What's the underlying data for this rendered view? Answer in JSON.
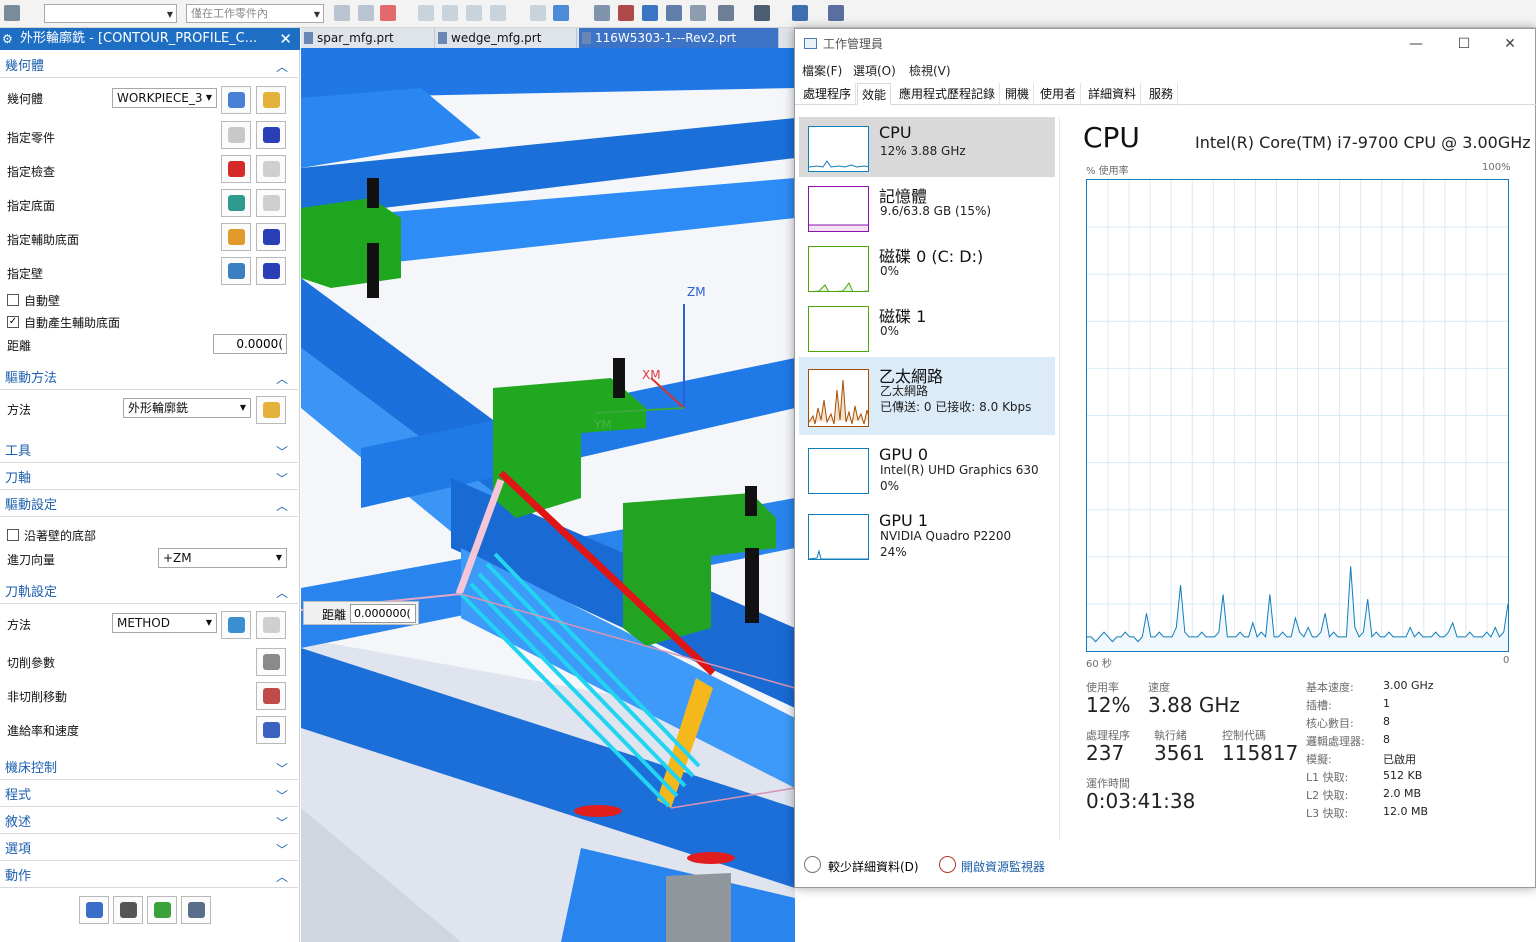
{
  "toolbar": {
    "combo1": "",
    "combo2": "僅在工作零件內"
  },
  "panel": {
    "title": "外形輪廓銑 - [CONTOUR_PROFILE_C...",
    "geometry": {
      "header": "幾何體",
      "geometry_label": "幾何體",
      "workpiece_value": "WORKPIECE_3",
      "specify_part": "指定零件",
      "specify_check": "指定檢查",
      "specify_floor": "指定底面",
      "specify_aux_floor": "指定輔助底面",
      "specify_wall": "指定壁",
      "auto_wall": "自動壁",
      "auto_aux_floor": "自動產生輔助底面",
      "distance_label": "距離",
      "distance_value": "0.0000("
    },
    "drive": {
      "header": "驅動方法",
      "method_label": "方法",
      "method_value": "外形輪廓銑"
    },
    "tool_header": "工具",
    "axis_header": "刀軸",
    "drive_settings": {
      "header": "驅動設定",
      "along_wall_bottom": "沿著壁的底部",
      "approach_label": "進刀向量",
      "approach_value": "+ZM"
    },
    "path_settings": {
      "header": "刀軌設定",
      "method_label": "方法",
      "method_value": "METHOD",
      "cut_params": "切削參數",
      "non_cut": "非切削移動",
      "feeds": "進給率和速度"
    },
    "machine_control": "機床控制",
    "program": "程式",
    "description": "敘述",
    "options": "選項",
    "actions": "動作"
  },
  "viewport": {
    "tabs": [
      "spar_mfg.prt",
      "wedge_mfg.prt",
      "116W5303-1---Rev2.prt"
    ],
    "axis_zm": "ZM",
    "axis_xm": "XM",
    "axis_ym": "YM",
    "distance_label": "距離",
    "distance_value": "0.000000("
  },
  "taskmgr": {
    "title": "工作管理員",
    "menu": [
      "檔案(F)",
      "選項(O)",
      "檢視(V)"
    ],
    "tabs": [
      "處理程序",
      "效能",
      "應用程式歷程記錄",
      "開機",
      "使用者",
      "詳細資料",
      "服務"
    ],
    "sidebar": [
      {
        "name": "CPU",
        "sub1": "12%  3.88 GHz",
        "sub2": ""
      },
      {
        "name": "記憶體",
        "sub1": "9.6/63.8 GB (15%)",
        "sub2": ""
      },
      {
        "name": "磁碟 0 (C: D:)",
        "sub1": "0%",
        "sub2": ""
      },
      {
        "name": "磁碟 1",
        "sub1": "0%",
        "sub2": ""
      },
      {
        "name": "乙太網路",
        "sub1": "乙太網路",
        "sub2": "已傳送: 0  已接收: 8.0 Kbps"
      },
      {
        "name": "GPU 0",
        "sub1": "Intel(R) UHD Graphics 630",
        "sub2": "0%"
      },
      {
        "name": "GPU 1",
        "sub1": "NVIDIA Quadro P2200",
        "sub2": "24%"
      }
    ],
    "cpu_title": "CPU",
    "cpu_model": "Intel(R) Core(TM) i7-9700 CPU @ 3.00GHz",
    "graph_label": "% 使用率",
    "graph_max": "100%",
    "graph_time": "60 秒",
    "graph_min": "0",
    "utilization_label": "使用率",
    "utilization_value": "12%",
    "speed_label": "速度",
    "speed_value": "3.88 GHz",
    "processes_label": "處理程序",
    "processes_value": "237",
    "threads_label": "執行緒",
    "threads_value": "3561",
    "handles_label": "控制代碼",
    "handles_value": "115817",
    "uptime_label": "運作時間",
    "uptime_value": "0:03:41:38",
    "specs": [
      {
        "k": "基本速度:",
        "v": "3.00 GHz"
      },
      {
        "k": "插槽:",
        "v": "1"
      },
      {
        "k": "核心數目:",
        "v": "8"
      },
      {
        "k": "邏輯處理器:",
        "v": "8"
      },
      {
        "k": "模擬:",
        "v": "已啟用"
      },
      {
        "k": "L1 快取:",
        "v": "512 KB"
      },
      {
        "k": "L2 快取:",
        "v": "2.0 MB"
      },
      {
        "k": "L3 快取:",
        "v": "12.0 MB"
      }
    ],
    "fewer_details": "較少詳細資料(D)",
    "open_monitor": "開啟資源監視器",
    "cpu_history": [
      3,
      3,
      2,
      3,
      4,
      3,
      2,
      3,
      3,
      4,
      3,
      3,
      2,
      3,
      8,
      3,
      3,
      4,
      3,
      3,
      3,
      5,
      14,
      4,
      3,
      3,
      3,
      4,
      3,
      3,
      3,
      4,
      12,
      3,
      3,
      3,
      4,
      3,
      3,
      6,
      3,
      4,
      3,
      12,
      3,
      3,
      4,
      3,
      3,
      7,
      4,
      3,
      5,
      3,
      3,
      4,
      8,
      3,
      4,
      3,
      3,
      3,
      18,
      5,
      3,
      4,
      11,
      3,
      4,
      3,
      3,
      4,
      3,
      3,
      3,
      3,
      5,
      3,
      4,
      3,
      3,
      3,
      4,
      3,
      3,
      4,
      6,
      3,
      3,
      3,
      4,
      3,
      3,
      3,
      4,
      3,
      5,
      3,
      4,
      10
    ]
  },
  "colors": {
    "accent": "#1e6fc4",
    "graph_line": "#117dbb",
    "graph_grid": "#d9eaf4",
    "cad_blue": "#1a73e8",
    "cad_green": "#1fa61f"
  }
}
